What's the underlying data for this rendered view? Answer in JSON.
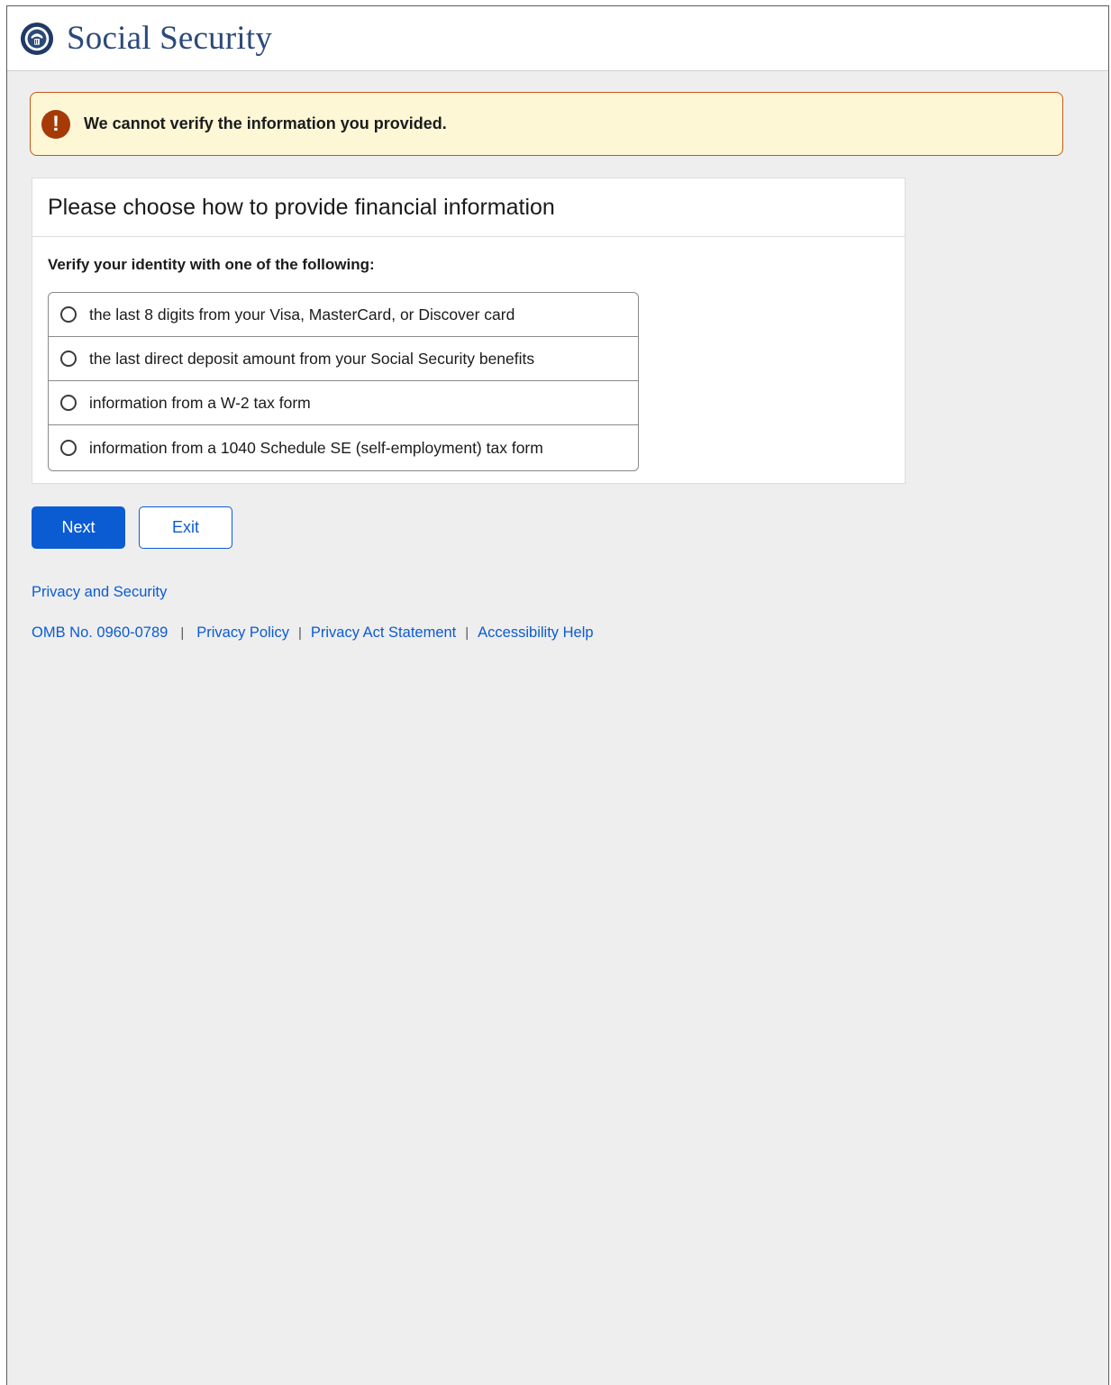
{
  "header": {
    "brand": "Social Security",
    "seal_icon": "ssa-seal-icon"
  },
  "alert": {
    "icon": "exclamation-icon",
    "message": "We cannot verify the information you provided.",
    "border_color": "#c8561a",
    "background": "#fdf7d6"
  },
  "card": {
    "title": "Please choose how to provide financial information",
    "prompt": "Verify your identity with one of the following:",
    "options": [
      {
        "label": "the last 8 digits from your Visa, MasterCard, or Discover card",
        "selected": false
      },
      {
        "label": "the last direct deposit amount from your Social Security benefits",
        "selected": false
      },
      {
        "label": "information from a W-2 tax form",
        "selected": false
      },
      {
        "label": "information from a 1040 Schedule SE (self-employment) tax form",
        "selected": false
      }
    ]
  },
  "actions": {
    "next_label": "Next",
    "exit_label": "Exit",
    "primary_color": "#0b5bd3"
  },
  "links": {
    "privacy_security": "Privacy and Security"
  },
  "footer": {
    "omb": "OMB No. 0960-0789",
    "sep": "|",
    "privacy_policy": "Privacy Policy",
    "privacy_act": "Privacy Act Statement",
    "accessibility": "Accessibility Help"
  }
}
